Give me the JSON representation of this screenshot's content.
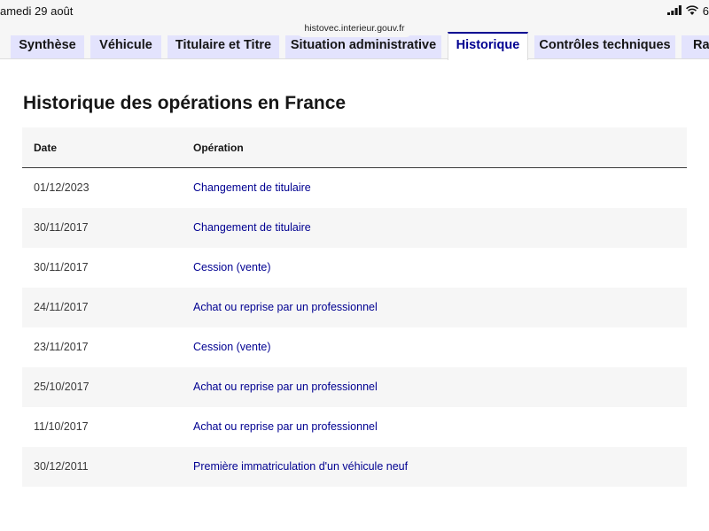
{
  "status_bar": {
    "time": "amedi 29 août",
    "battery": "6"
  },
  "browser": {
    "url": "histovec.interieur.gouv.fr"
  },
  "tabs": [
    {
      "label": "Synthèse",
      "active": false
    },
    {
      "label": "Véhicule",
      "active": false
    },
    {
      "label": "Titulaire et Titre",
      "active": false
    },
    {
      "label": "Situation administrative",
      "active": false
    },
    {
      "label": "Historique",
      "active": true
    },
    {
      "label": "Contrôles techniques",
      "active": false
    },
    {
      "label": "Rap",
      "active": false
    }
  ],
  "page": {
    "title": "Historique des opérations en France"
  },
  "table": {
    "headers": {
      "date": "Date",
      "operation": "Opération"
    },
    "rows": [
      {
        "date": "01/12/2023",
        "operation": "Changement de titulaire"
      },
      {
        "date": "30/11/2017",
        "operation": "Changement de titulaire"
      },
      {
        "date": "30/11/2017",
        "operation": "Cession (vente)"
      },
      {
        "date": "24/11/2017",
        "operation": "Achat ou reprise par un professionnel"
      },
      {
        "date": "23/11/2017",
        "operation": "Cession (vente)"
      },
      {
        "date": "25/10/2017",
        "operation": "Achat ou reprise par un professionnel"
      },
      {
        "date": "11/10/2017",
        "operation": "Achat ou reprise par un professionnel"
      },
      {
        "date": "30/12/2011",
        "operation": "Première immatriculation d'un véhicule neuf"
      }
    ]
  },
  "colors": {
    "accent": "#000091",
    "tab_bg": "#e3e3fd",
    "stripe": "#f6f6f6"
  },
  "icons": [
    "signal-icon",
    "wifi-icon"
  ]
}
